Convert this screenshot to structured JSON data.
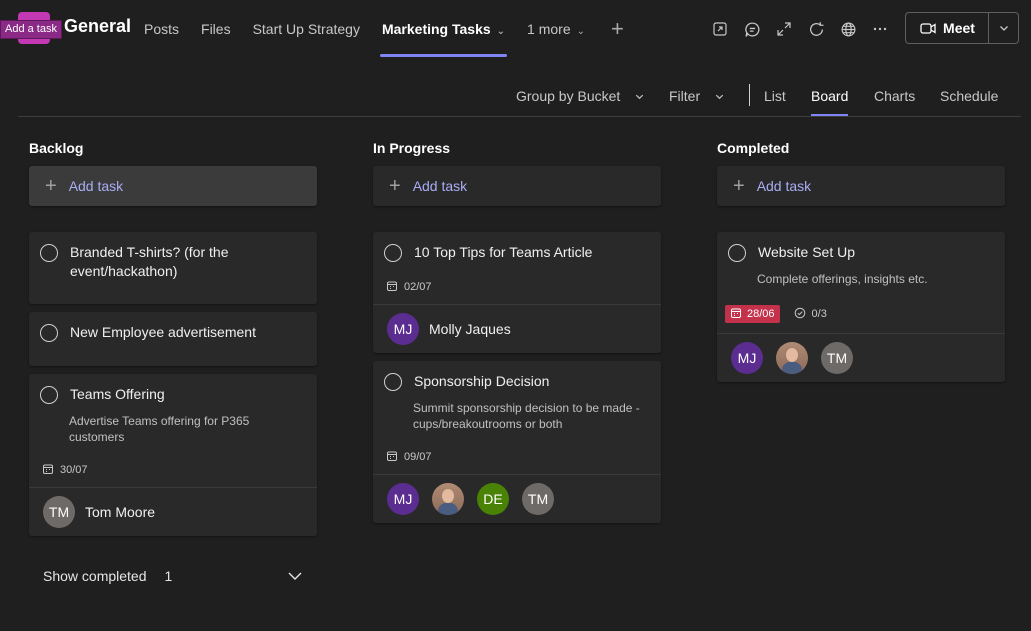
{
  "tooltip": "Add a task",
  "channel_title": "General",
  "tabs": {
    "posts": "Posts",
    "files": "Files",
    "startup": "Start Up Strategy",
    "marketing": "Marketing Tasks",
    "more": "1 more"
  },
  "meet_label": "Meet",
  "viewbar": {
    "group_by": "Group by Bucket",
    "filter": "Filter",
    "list": "List",
    "board": "Board",
    "charts": "Charts",
    "schedule": "Schedule"
  },
  "colors": {
    "accent": "#7f85f5",
    "overdue": "#c4314b"
  },
  "columns": [
    {
      "title": "Backlog",
      "add_label": "Add task",
      "cards": [
        {
          "title": "Branded T-shirts? (for the event/hackathon)"
        },
        {
          "title": "New Employee advertisement"
        },
        {
          "title": "Teams Offering",
          "description": "Advertise Teams offering for P365 customers",
          "due": "30/07",
          "assignee": {
            "initials": "TM",
            "name": "Tom Moore"
          }
        }
      ],
      "show_completed": {
        "label": "Show completed",
        "count": "1"
      }
    },
    {
      "title": "In Progress",
      "add_label": "Add task",
      "cards": [
        {
          "title": "10 Top Tips for Teams Article",
          "due": "02/07",
          "assignee": {
            "initials": "MJ",
            "name": "Molly Jaques"
          }
        },
        {
          "title": "Sponsorship Decision",
          "description": "Summit sponsorship decision to be made - cups/breakoutrooms or both",
          "due": "09/07",
          "assignees": [
            "MJ",
            "DE",
            "TM"
          ]
        }
      ]
    },
    {
      "title": "Completed",
      "add_label": "Add task",
      "cards": [
        {
          "title": "Website Set Up",
          "description": "Complete offerings, insights etc.",
          "due": "28/06",
          "checklist": "0/3",
          "assignees": [
            "MJ",
            "TM"
          ]
        }
      ]
    }
  ]
}
